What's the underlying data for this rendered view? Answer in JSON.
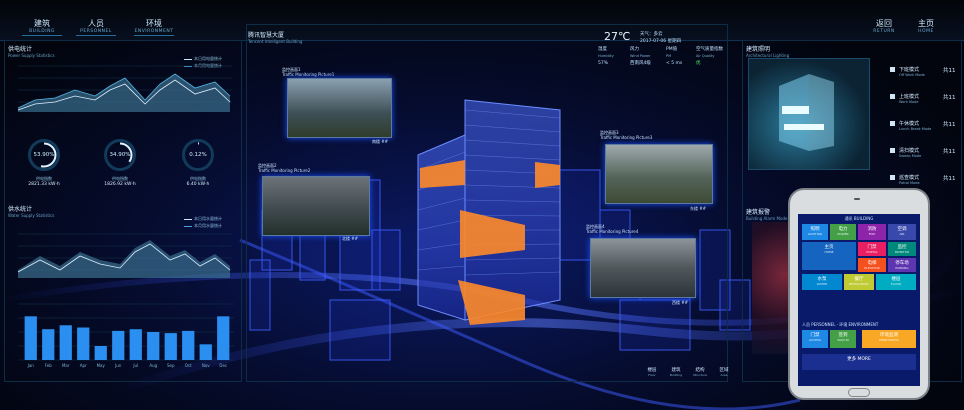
{
  "nav": {
    "left": [
      {
        "cn": "建筑",
        "en": "BUILDING"
      },
      {
        "cn": "人员",
        "en": "PERSONNEL"
      },
      {
        "cn": "环境",
        "en": "ENVIRONMENT"
      }
    ],
    "right": [
      {
        "cn": "返回",
        "en": "RETURN"
      },
      {
        "cn": "主页",
        "en": "HOME"
      }
    ]
  },
  "power": {
    "title": "供电统计",
    "subtitle": "Power Supply Statistics",
    "legend": [
      "本日用电量统计",
      "本月用电量统计"
    ]
  },
  "gauges": [
    {
      "value": "53.90%",
      "label": "供电指数",
      "amount": "2821.33 kW·h",
      "ratio": 0.539
    },
    {
      "value": "34.90%",
      "label": "供电指数",
      "amount": "1826.92 kW·h",
      "ratio": 0.349
    },
    {
      "value": "0.12%",
      "label": "供电指数",
      "amount": "6.40 kW·h",
      "ratio": 0.0012
    }
  ],
  "water": {
    "title": "供水统计",
    "subtitle": "Water Supply Statistics",
    "legend": [
      "本日用水量统计",
      "本月用水量统计"
    ]
  },
  "chart_data": {
    "type": "bar",
    "categories": [
      "Jan",
      "Feb",
      "Mar",
      "Apr",
      "May",
      "Jun",
      "Jul",
      "Aug",
      "Sep",
      "Oct",
      "Nov",
      "Dec"
    ],
    "values": [
      78,
      55,
      62,
      58,
      25,
      52,
      55,
      50,
      48,
      52,
      28,
      78
    ],
    "ylim": [
      0,
      100
    ]
  },
  "center": {
    "title": "腾讯智慧大厦",
    "subtitle": "Tencent Intelligent Building"
  },
  "weather": {
    "temp": "27℃",
    "desc": "天气：多云",
    "date": "2017-07-06",
    "day": "星期四",
    "cols": [
      [
        "湿度",
        "Humidity",
        "57%"
      ],
      [
        "风力",
        "Wind Power",
        "西南风4级"
      ],
      [
        "PM值",
        "PM",
        "< 5 ms"
      ],
      [
        "空气质量指数",
        "Air Quality",
        "优"
      ]
    ]
  },
  "cameras": [
    {
      "title": "监控画面1",
      "sub": "Traffic Monitoring Picture1",
      "caption": "南楼 ##"
    },
    {
      "title": "监控画面2",
      "sub": "Traffic Monitoring Picture2",
      "caption": "北楼 ##"
    },
    {
      "title": "监控画面3",
      "sub": "Traffic Monitoring Picture3",
      "caption": "东楼 ##"
    },
    {
      "title": "监控画面4",
      "sub": "Traffic Monitoring Picture4",
      "caption": "西楼 ##"
    }
  ],
  "right": {
    "title1": "建筑照明",
    "sub1": "Architectural Lighting",
    "title2": "建筑报警",
    "sub2": "Building Alarm Mode",
    "modes": [
      {
        "cn": "下班模式",
        "en": "Off Work Mode",
        "count": "共11"
      },
      {
        "cn": "上班模式",
        "en": "Work Mode",
        "count": "共11"
      },
      {
        "cn": "午休模式",
        "en": "Lunch Break Mode",
        "count": "共11"
      },
      {
        "cn": "清扫模式",
        "en": "Sweep Mode",
        "count": "共11"
      },
      {
        "cn": "巡查模式",
        "en": "Patrol Mode",
        "count": "共11"
      }
    ]
  },
  "bottomTabs": [
    {
      "cn": "楼层",
      "en": "Floor"
    },
    {
      "cn": "建筑",
      "en": "Building"
    },
    {
      "cn": "结构",
      "en": "Structure"
    },
    {
      "cn": "区域",
      "en": "Area"
    }
  ],
  "phone": {
    "header": "通讯 BUILDING",
    "tiles": [
      {
        "cn": "照明",
        "en": "LIGHTING",
        "color": "#1e88e5"
      },
      {
        "cn": "电力",
        "en": "POWER",
        "color": "#43a047"
      },
      {
        "cn": "消防",
        "en": "FIRE",
        "color": "#8e24aa"
      },
      {
        "cn": "空调",
        "en": "AIR",
        "color": "#3949ab"
      },
      {
        "cn": "主页",
        "en": "HOME",
        "color": "#1565c0"
      },
      {
        "cn": "门禁",
        "en": "PORTAL",
        "color": "#e91e63"
      },
      {
        "cn": "监控",
        "en": "MONITOR",
        "color": "#00897b"
      },
      {
        "cn": "电梯",
        "en": "ELEVATOR",
        "color": "#f4511e"
      },
      {
        "cn": "停车场",
        "en": "PARKING",
        "color": "#5e35b1"
      },
      {
        "cn": "水泵",
        "en": "WATER",
        "color": "#0288d1"
      },
      {
        "cn": "餐厅",
        "en": "RESTAURANT",
        "color": "#c0ca33"
      },
      {
        "cn": "楼层",
        "en": "FLOOR",
        "color": "#00acc1"
      }
    ],
    "header2": "人员 PERSONNEL",
    "header3": "环境 ENVIRONMENT",
    "tiles2": [
      {
        "cn": "门禁",
        "en": "ACCESS",
        "color": "#1e88e5"
      },
      {
        "cn": "签到",
        "en": "SIGN IN",
        "color": "#43a047"
      },
      {
        "cn": "环境监测",
        "en": "MONITORING",
        "color": "#f9a825"
      }
    ],
    "more": "更多 MORE"
  }
}
